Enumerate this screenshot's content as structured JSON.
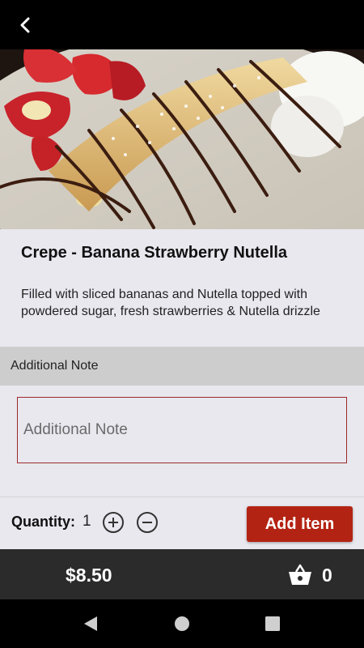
{
  "header": {
    "back_icon": "chevron-left-icon"
  },
  "item": {
    "image_alt": "Crepe with bananas, strawberries, powdered sugar and Nutella drizzle",
    "title": "Crepe - Banana Strawberry Nutella",
    "description": "Filled with sliced bananas and Nutella topped with powdered sugar, fresh strawberries & Nutella drizzle"
  },
  "note": {
    "header_label": "Additional Note",
    "placeholder": "Additional Note",
    "value": ""
  },
  "quantity": {
    "label": "Quantity:",
    "value": "1",
    "plus_icon": "plus-circle-icon",
    "minus_icon": "minus-circle-icon"
  },
  "add_button_label": "Add Item",
  "cart": {
    "total": "$8.50",
    "count": "0",
    "icon": "basket-icon"
  },
  "system_nav": {
    "back_icon": "triangle-back-icon",
    "home_icon": "circle-home-icon",
    "recents_icon": "square-recents-icon"
  },
  "colors": {
    "accent": "#b32313",
    "content_bg": "#e9e8ef",
    "note_header_bg": "#cdcdcd",
    "cart_bar_bg": "#2b2b2b",
    "input_border": "#9b2a2a"
  }
}
